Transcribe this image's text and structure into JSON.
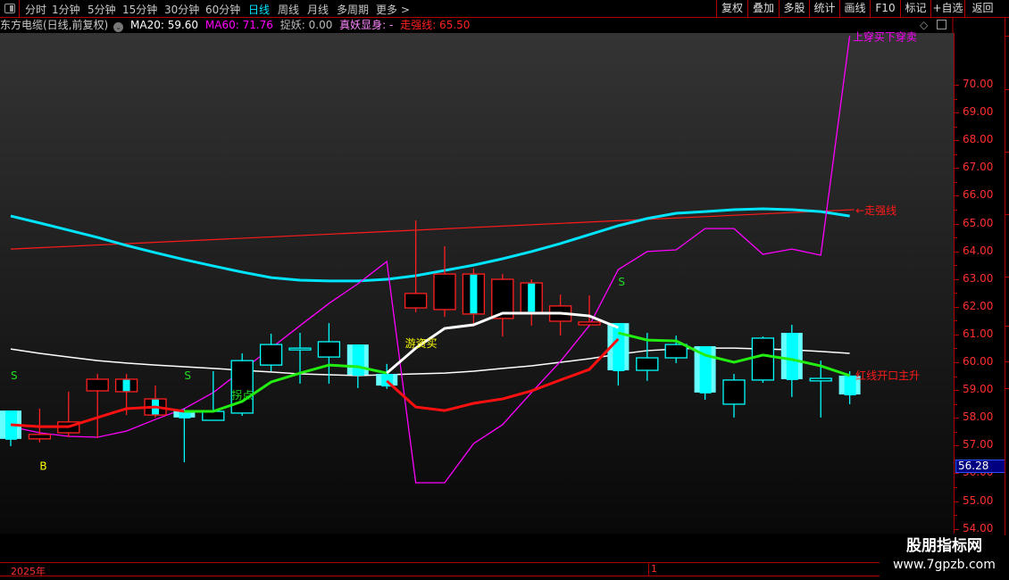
{
  "toolbar": {
    "periods": [
      "分时",
      "1分钟",
      "5分钟",
      "15分钟",
      "30分钟",
      "60分钟",
      "日线",
      "周线",
      "月线",
      "多周期",
      "更多 >"
    ],
    "active_period": "日线",
    "right_buttons": [
      "复权",
      "叠加",
      "多股",
      "统计",
      "画线",
      "F10",
      "标记",
      "+自选",
      "返回"
    ]
  },
  "info": {
    "title": "东方电缆(日线,前复权)",
    "ma20": "MA20: 59.60",
    "ma60": "MA60: 71.76",
    "zhuoyao": "捉妖: 0.00",
    "zhenyao": "真妖显身: -",
    "zouqiang": "走强线: 65.50"
  },
  "colors": {
    "up": "#ff2020",
    "down": "#00ffff",
    "down_light": "#66ffff",
    "ma20": "#ffffff",
    "ma60": "#ff00ff",
    "mid": "#00e5ff",
    "zouqiang": "#ff1a1a",
    "trend_green": "#22ee11",
    "trend_red": "#ff1010",
    "trend_white": "#ffffff",
    "axis": "#ff3030"
  },
  "axis": {
    "ticks": [
      "70.00",
      "69.00",
      "68.00",
      "67.00",
      "66.00",
      "65.00",
      "64.00",
      "63.00",
      "62.00",
      "61.00",
      "60.00",
      "59.00",
      "58.00",
      "57.00",
      "56.00",
      "55.00",
      "54.00"
    ],
    "current_price": "56.28"
  },
  "timebar": {
    "year": "2025年",
    "month": "1"
  },
  "watermark": {
    "line1": "股朋指标网",
    "line2": "www.7gpzb.com"
  },
  "chart_data": {
    "type": "candlestick",
    "ylim": [
      54,
      71.9
    ],
    "candles": [
      {
        "o": 58.26,
        "h": 58.26,
        "l": 56.98,
        "c": 57.24,
        "s": "down"
      },
      {
        "o": 57.24,
        "h": 58.33,
        "l": 57.11,
        "c": 57.4,
        "s": "up"
      },
      {
        "o": 57.46,
        "h": 58.94,
        "l": 57.3,
        "c": 57.85,
        "s": "up"
      },
      {
        "o": 58.97,
        "h": 59.58,
        "l": 57.27,
        "c": 59.39,
        "s": "up"
      },
      {
        "o": 58.94,
        "h": 59.58,
        "l": 58.1,
        "c": 59.39,
        "s": "upfill"
      },
      {
        "o": 58.1,
        "h": 59.16,
        "l": 58.01,
        "c": 58.68,
        "s": "upfill"
      },
      {
        "o": 58.26,
        "h": 58.33,
        "l": 56.4,
        "c": 58.01,
        "s": "down"
      },
      {
        "o": 57.91,
        "h": 59.68,
        "l": 57.91,
        "c": 58.23,
        "s": "upcyan"
      },
      {
        "o": 58.17,
        "h": 60.32,
        "l": 58.07,
        "c": 60.06,
        "s": "upcyan"
      },
      {
        "o": 59.9,
        "h": 61.03,
        "l": 59.68,
        "c": 60.64,
        "s": "upcyan"
      },
      {
        "o": 60.48,
        "h": 61.06,
        "l": 59.23,
        "c": 60.51,
        "s": "upcyan"
      },
      {
        "o": 60.19,
        "h": 61.41,
        "l": 59.23,
        "c": 60.74,
        "s": "upcyan"
      },
      {
        "o": 60.64,
        "h": 60.64,
        "l": 59.07,
        "c": 59.55,
        "s": "down"
      },
      {
        "o": 59.58,
        "h": 59.94,
        "l": 59.04,
        "c": 59.16,
        "s": "down"
      },
      {
        "o": 61.96,
        "h": 65.11,
        "l": 61.8,
        "c": 62.48,
        "s": "up"
      },
      {
        "o": 61.9,
        "h": 64.18,
        "l": 61.64,
        "c": 63.18,
        "s": "up"
      },
      {
        "o": 61.74,
        "h": 63.38,
        "l": 61.29,
        "c": 63.18,
        "s": "upfill"
      },
      {
        "o": 61.58,
        "h": 63.18,
        "l": 60.93,
        "c": 62.99,
        "s": "up"
      },
      {
        "o": 61.8,
        "h": 62.99,
        "l": 61.32,
        "c": 62.86,
        "s": "upfill"
      },
      {
        "o": 61.48,
        "h": 62.44,
        "l": 60.96,
        "c": 62.03,
        "s": "up"
      },
      {
        "o": 61.35,
        "h": 62.41,
        "l": 61.35,
        "c": 61.45,
        "s": "up"
      },
      {
        "o": 61.41,
        "h": 61.41,
        "l": 59.16,
        "c": 59.71,
        "s": "down"
      },
      {
        "o": 59.71,
        "h": 61.06,
        "l": 59.33,
        "c": 60.16,
        "s": "upcyan"
      },
      {
        "o": 60.16,
        "h": 60.96,
        "l": 59.97,
        "c": 60.64,
        "s": "upcyan"
      },
      {
        "o": 60.58,
        "h": 60.58,
        "l": 58.65,
        "c": 58.91,
        "s": "down"
      },
      {
        "o": 58.49,
        "h": 59.58,
        "l": 58.01,
        "c": 59.36,
        "s": "upcyan"
      },
      {
        "o": 59.36,
        "h": 60.93,
        "l": 59.26,
        "c": 60.87,
        "s": "upcyan"
      },
      {
        "o": 61.06,
        "h": 61.35,
        "l": 58.75,
        "c": 59.39,
        "s": "down"
      },
      {
        "o": 59.33,
        "h": 60.06,
        "l": 58.01,
        "c": 59.42,
        "s": "upcyan"
      },
      {
        "o": 59.52,
        "h": 59.68,
        "l": 58.49,
        "c": 58.84,
        "s": "down"
      }
    ],
    "lines": {
      "white_thin": [
        60.48,
        60.32,
        60.19,
        60.06,
        59.97,
        59.9,
        59.84,
        59.78,
        59.71,
        59.65,
        59.58,
        59.55,
        59.52,
        59.55,
        59.58,
        59.61,
        59.68,
        59.78,
        59.87,
        60.0,
        60.13,
        60.29,
        60.42,
        60.48,
        60.51,
        60.51,
        60.48,
        60.45,
        60.39,
        60.32
      ],
      "cyan_thick": [
        65.27,
        65.02,
        64.76,
        64.5,
        64.21,
        63.95,
        63.7,
        63.47,
        63.25,
        63.05,
        62.96,
        62.93,
        62.93,
        62.99,
        63.12,
        63.31,
        63.5,
        63.73,
        63.99,
        64.28,
        64.6,
        64.92,
        65.18,
        65.37,
        65.43,
        65.5,
        65.53,
        65.5,
        65.43,
        65.27
      ],
      "magenta": [
        57.68,
        57.46,
        57.33,
        57.3,
        57.52,
        57.94,
        58.33,
        58.91,
        59.71,
        60.51,
        61.32,
        62.12,
        62.83,
        63.63,
        55.66,
        55.66,
        57.07,
        57.75,
        58.91,
        60.03,
        61.32,
        63.34,
        63.99,
        64.05,
        64.82,
        64.82,
        63.89,
        64.08,
        63.86,
        71.76
      ],
      "zouqiang": {
        "start": 64.08,
        "end": 65.5
      },
      "trend_segments": [
        {
          "color": "trend_red",
          "start": 0,
          "values": [
            57.75,
            57.68,
            57.68,
            58.01,
            58.33,
            58.39,
            58.23
          ]
        },
        {
          "color": "trend_green",
          "start": 6,
          "values": [
            58.23,
            58.23,
            58.59,
            59.29,
            59.61,
            59.9,
            59.84,
            59.61
          ]
        },
        {
          "color": "trend_white",
          "start": 13,
          "values": [
            59.61,
            60.51,
            61.22,
            61.35,
            61.77,
            61.77,
            61.77,
            61.67,
            61.25
          ]
        },
        {
          "color": "trend_red",
          "start": 13,
          "values": [
            59.33,
            58.39,
            58.26,
            58.52,
            58.68,
            58.97,
            59.36,
            59.74,
            60.84
          ]
        },
        {
          "color": "trend_green",
          "start": 21,
          "values": [
            61.06,
            60.8,
            60.77,
            60.26,
            60.0,
            60.26,
            60.1,
            59.87,
            59.52
          ]
        }
      ]
    },
    "annotations": [
      {
        "text": "S",
        "bar": 0,
        "price": 59.55,
        "color": "#22dd22"
      },
      {
        "text": "S",
        "bar": 6,
        "price": 59.55,
        "color": "#22dd22"
      },
      {
        "text": "S",
        "bar": 21,
        "price": 62.93,
        "color": "#22dd22"
      },
      {
        "text": "B",
        "bar": 1,
        "price": 56.28,
        "color": "#ffff00"
      },
      {
        "text": "拐点",
        "bar": 8,
        "price": 58.85,
        "color": "#22dd22"
      },
      {
        "text": "游资买",
        "bar": 14,
        "price": 60.7,
        "color": "#ffff00"
      },
      {
        "text": "←走强线",
        "bar": 29.2,
        "price": 65.5,
        "color": "#ff1a1a"
      },
      {
        "text": "红线开口主升",
        "bar": 29.2,
        "price": 59.55,
        "color": "#ff1a1a"
      },
      {
        "text": "上穿买下穿卖",
        "bar": 29.1,
        "price": 71.76,
        "color": "#ff00ff"
      }
    ]
  }
}
